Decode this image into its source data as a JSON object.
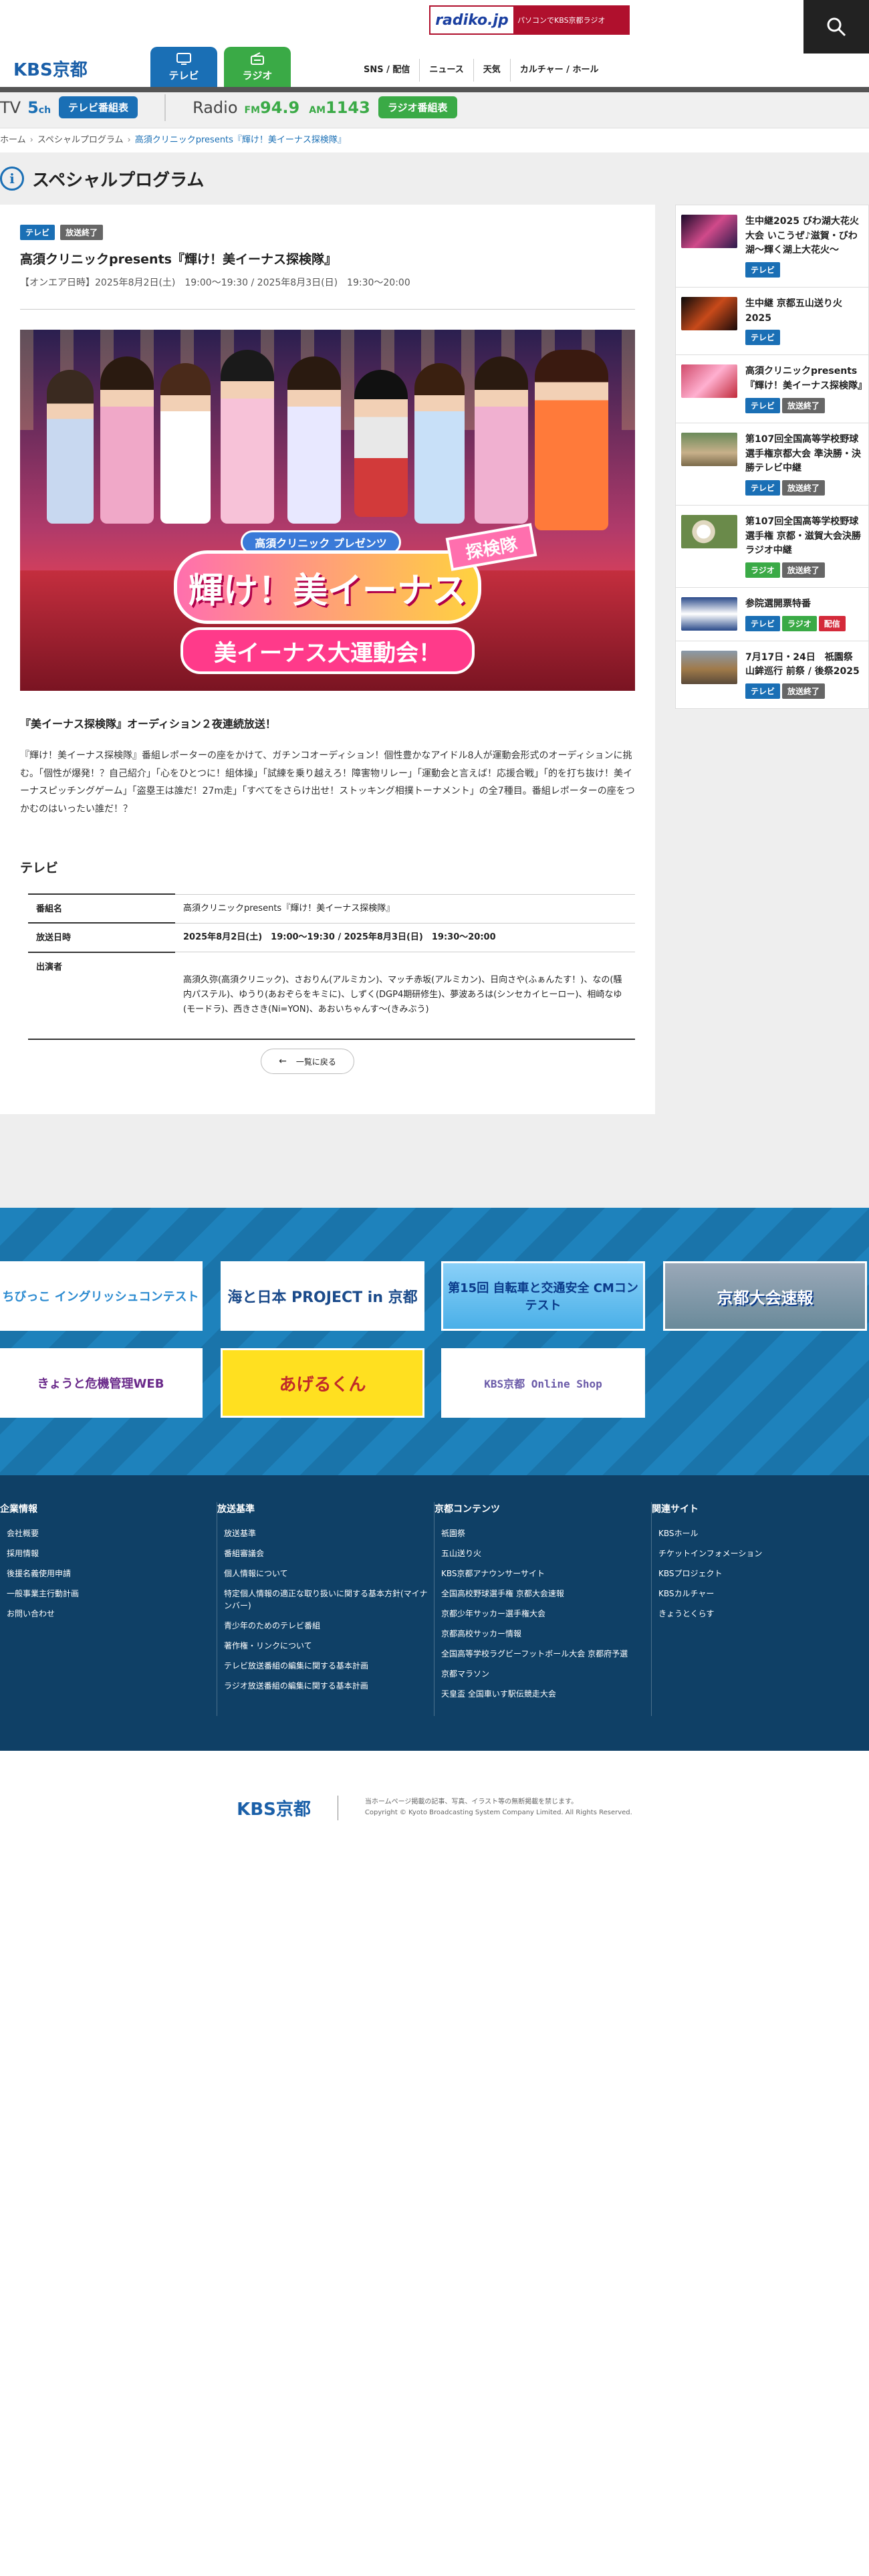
{
  "header": {
    "logo": "KBS京都",
    "radiko_logo": "radiko.jp",
    "radiko_text": "パソコンでKBS京都ラジオ",
    "tab_tv": "テレビ",
    "tab_radio": "ラジオ",
    "nav": [
      "SNS / 配信",
      "ニュース",
      "天気",
      "カルチャー / ホール"
    ]
  },
  "program_bar": {
    "tv_label": "TV",
    "tv_channel": "5",
    "tv_channel_unit": "ch",
    "tv_button": "テレビ番組表",
    "radio_label": "Radio",
    "fm_label": "FM",
    "fm_freq": "94.9",
    "am_label": "AM",
    "am_freq": "1143",
    "radio_button": "ラジオ番組表"
  },
  "breadcrumb": {
    "home": "ホーム",
    "section": "スペシャルプログラム",
    "current": "高須クリニックpresents『輝け！美イーナス探検隊』"
  },
  "page_title": "スペシャルプログラム",
  "article": {
    "badges": [
      "テレビ",
      "放送終了"
    ],
    "title": "高須クリニックpresents『輝け！美イーナス探検隊』",
    "airdate": "【オンエア日時】2025年8月2日(土)　19:00〜19:30 / 2025年8月3日(日)　19:30〜20:00",
    "hero": {
      "sub": "高須クリニック プレゼンツ",
      "logo1": "輝け！美イーナス",
      "sticker": "探検隊",
      "logo2": "美イーナス大運動会！"
    },
    "lead": "『美イーナス探検隊』オーディション２夜連続放送！",
    "body": "『輝け！美イーナス探検隊』番組レポーターの座をかけて、ガチンコオーディション！個性豊かなアイドル8人が運動会形式のオーディションに挑む。「個性が爆発！？自己紹介」「心をひとつに！組体操」「試練を乗り越えろ！障害物リレー」「運動会と言えば！応援合戦」「的を打ち抜け！美イーナスピッチングゲーム」「盗塁王は誰だ！27m走」「すべてをさらけ出せ！ストッキング相撲トーナメント」の全7種目。番組レポーターの座をつかむのはいったい誰だ！？",
    "section_tv": "テレビ",
    "info_rows": [
      {
        "label": "番組名",
        "value": "高須クリニックpresents『輝け！美イーナス探検隊』"
      },
      {
        "label": "放送日時",
        "value": "2025年8月2日(土)　19:00〜19:30 / 2025年8月3日(日)　19:30〜20:00"
      },
      {
        "label": "出演者",
        "value": "高須久弥(高須クリニック)、さおりん(アルミカン)、マッチ赤坂(アルミカン)、日向さや(ふぁんたす！)、なの(騒内パステル)、ゆうり(あおぞらをキミに)、しずく(DGP4期研修生)、夢波あろは(シンセカイヒーロー)、相崎なゆ(モードラ)、西きさき(Ni=YON)、あおいちゃんす〜(きみぶう)"
      }
    ],
    "back_button": "一覧に戻る"
  },
  "sidebar": [
    {
      "title": "生中継2025 びわ湖大花火大会 いこうぜ♪滋賀・びわ湖〜輝く湖上大花火〜",
      "badges": [
        "テレビ"
      ]
    },
    {
      "title": "生中継 京都五山送り火2025",
      "badges": [
        "テレビ"
      ]
    },
    {
      "title": "高須クリニックpresents『輝け！美イーナス探検隊』",
      "badges": [
        "テレビ",
        "放送終了"
      ]
    },
    {
      "title": "第107回全国高等学校野球選手権京都大会 準決勝・決勝テレビ中継",
      "badges": [
        "テレビ",
        "放送終了"
      ]
    },
    {
      "title": "第107回全国高等学校野球選手権 京都・滋賀大会決勝 ラジオ中継",
      "badges": [
        "ラジオ",
        "放送終了"
      ]
    },
    {
      "title": "参院選開票特番",
      "badges": [
        "テレビ",
        "ラジオ",
        "配信"
      ]
    },
    {
      "title": "7月17日・24日　祇園祭 山鉾巡行 前祭 / 後祭2025",
      "badges": [
        "テレビ",
        "放送終了"
      ]
    }
  ],
  "banners": [
    {
      "text": "ちびっこ イングリッシュコンテスト"
    },
    {
      "text": "海と日本 PROJECT in 京都"
    },
    {
      "text": "第15回 自転車と交通安全 CMコンテスト"
    },
    {
      "text": "京都大会速報"
    },
    {
      "text": "きょうと危機管理WEB"
    },
    {
      "text": "あげるくん"
    },
    {
      "text": "KBS京都 Online Shop"
    }
  ],
  "footer": {
    "columns": [
      {
        "heading": "企業情報",
        "items": [
          "会社概要",
          "採用情報",
          "後援名義使用申請",
          "一般事業主行動計画",
          "お問い合わせ"
        ]
      },
      {
        "heading": "放送基準",
        "items": [
          "放送基準",
          "番組審議会",
          "個人情報について",
          "特定個人情報の適正な取り扱いに関する基本方針(マイナンバー)",
          "青少年のためのテレビ番組",
          "著作権・リンクについて",
          "テレビ放送番組の編集に関する基本計画",
          "ラジオ放送番組の編集に関する基本計画"
        ]
      },
      {
        "heading": "京都コンテンツ",
        "items": [
          "祇園祭",
          "五山送り火",
          "KBS京都アナウンサーサイト",
          "全国高校野球選手権 京都大会速報",
          "京都少年サッカー選手権大会",
          "京都高校サッカー情報",
          "全国高等学校ラグビーフットボール大会 京都府予選",
          "京都マラソン",
          "天皇盃 全国車いす駅伝競走大会"
        ]
      },
      {
        "heading": "関連サイト",
        "items": [
          "KBSホール",
          "チケットインフォメーション",
          "KBSプロジェクト",
          "KBSカルチャー",
          "きょうとくらす"
        ]
      }
    ],
    "copyright_logo": "KBS京都",
    "copyright_line1": "当ホームページ掲載の記事、写真、イラスト等の無断掲載を禁じます。",
    "copyright_line2": "Copyright © Kyoto Broadcasting System Company Limited. All Rights Reserved."
  },
  "colors": {
    "tv": "#1a6fb5",
    "radio": "#3aaa46",
    "end": "#666666",
    "live": "#d42a3a",
    "footer": "#0f4066"
  }
}
